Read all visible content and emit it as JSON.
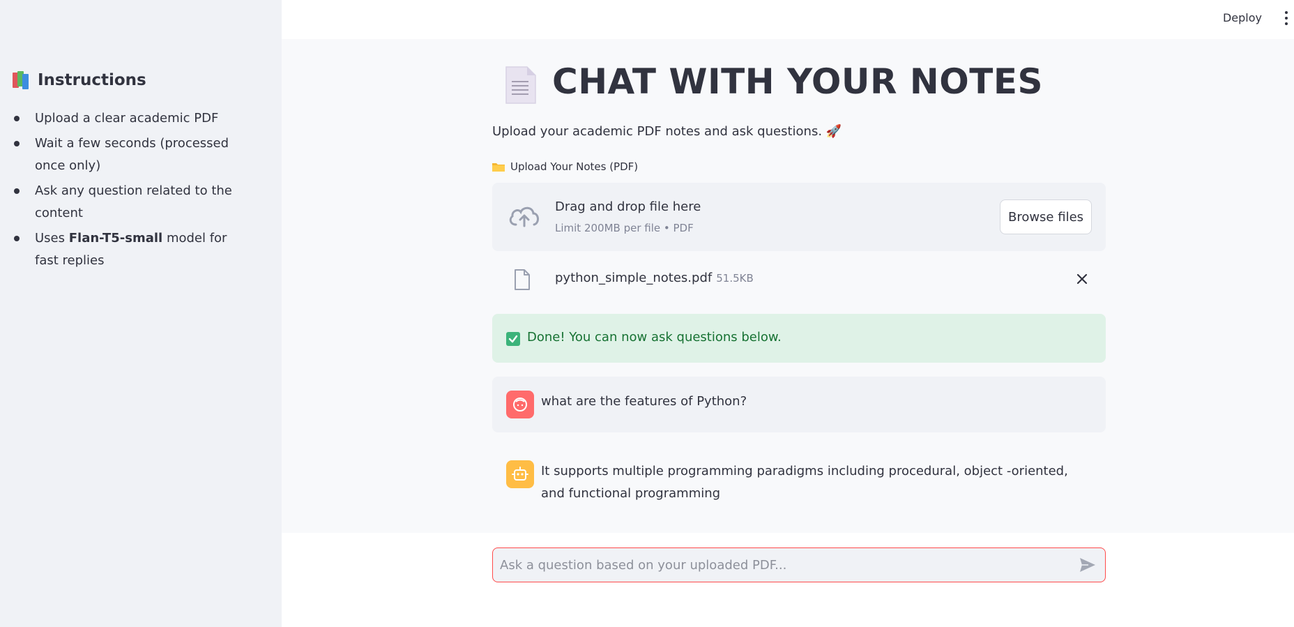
{
  "header": {
    "deploy_label": "Deploy"
  },
  "sidebar": {
    "title": "Instructions",
    "items": [
      {
        "text": "Upload a clear academic PDF"
      },
      {
        "text": "Wait a few seconds (processed once only)"
      },
      {
        "text_before": "Uses ",
        "bold": "Flan-T5-small",
        "text_after": " model for fast replies"
      },
      {
        "text": "Ask any question related to the content"
      }
    ]
  },
  "main": {
    "title": "CHAT WITH YOUR NOTES",
    "subtitle": "Upload your academic PDF notes and ask questions. 🚀",
    "uploader": {
      "label": "Upload Your Notes (PDF)",
      "drop_title": "Drag and drop file here",
      "drop_limit": "Limit 200MB per file • PDF",
      "browse_label": "Browse files"
    },
    "file": {
      "name": "python_simple_notes.pdf",
      "size": "51.5KB"
    },
    "status": {
      "message": "Done! You can now ask questions below."
    },
    "messages": [
      {
        "role": "user",
        "text": "what are the features of Python?"
      },
      {
        "role": "assistant",
        "text": "It supports multiple programming paradigms including procedural, object -oriented, and functional programming"
      }
    ],
    "chat_input": {
      "placeholder": "Ask a question based on your uploaded PDF..."
    }
  },
  "colors": {
    "sidebar_bg": "#f0f2f6",
    "accent_red": "#ff4b4b",
    "success_bg": "#dff2e7",
    "success_text": "#177233",
    "user_avatar": "#ff6b6b",
    "bot_avatar": "#ffbd45"
  },
  "icons": [
    "books-icon",
    "document-icon",
    "rocket-icon",
    "folder-icon",
    "cloud-upload-icon",
    "file-icon",
    "close-icon",
    "check-icon",
    "user-avatar-icon",
    "bot-avatar-icon",
    "send-icon",
    "kebab-menu-icon"
  ]
}
